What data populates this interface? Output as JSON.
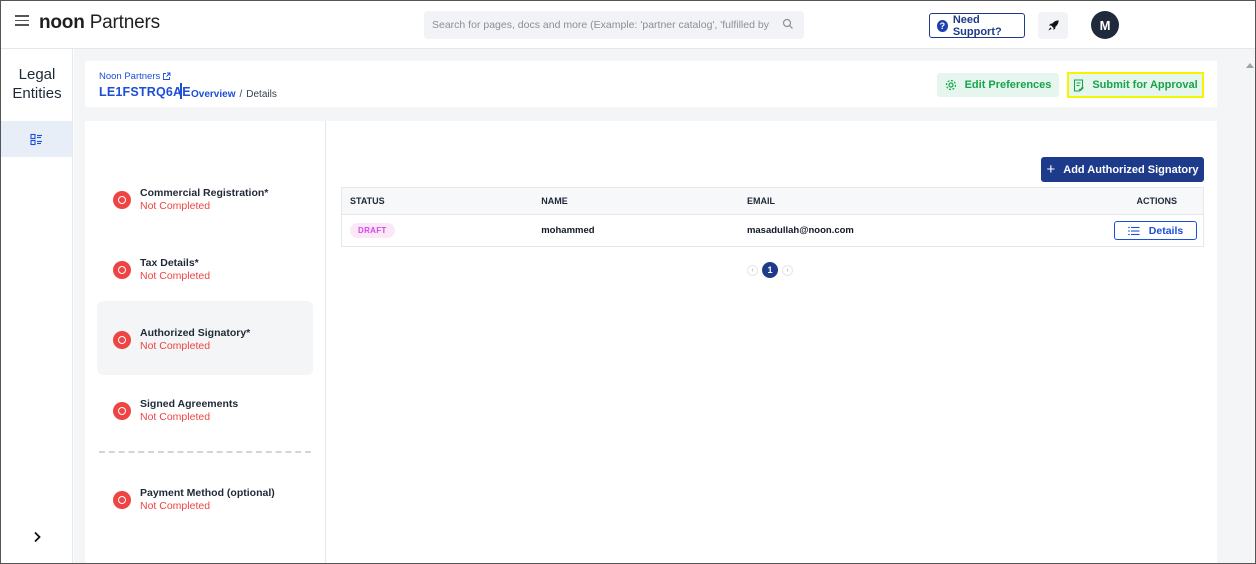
{
  "topbar": {
    "logo_bold": "noon",
    "logo_rest": " Partners",
    "search_placeholder": "Search for pages, docs and more (Example: 'partner catalog', 'fulfilled by p",
    "support_label": "Need Support?",
    "avatar_initial": "M"
  },
  "rail": {
    "title_line1": "Legal",
    "title_line2": "Entities"
  },
  "header": {
    "breadcrumb_link": "Noon Partners",
    "entity_id": "LE1FSTRQ6AE",
    "crumb_overview": "Overview",
    "crumb_separator": "/",
    "crumb_current": "Details",
    "edit_preferences_label": "Edit Preferences",
    "submit_label": "Submit for Approval"
  },
  "steps": [
    {
      "title": "Commercial Registration*",
      "status": "Not Completed"
    },
    {
      "title": "Tax Details*",
      "status": "Not Completed"
    },
    {
      "title": "Authorized Signatory*",
      "status": "Not Completed"
    },
    {
      "title": "Signed Agreements",
      "status": "Not Completed"
    },
    {
      "title": "Payment Method (optional)",
      "status": "Not Completed"
    }
  ],
  "panel": {
    "add_button_label": "Add Authorized Signatory",
    "columns": [
      "STATUS",
      "NAME",
      "EMAIL",
      "ACTIONS"
    ],
    "rows": [
      {
        "status": "DRAFT",
        "name": "mohammed",
        "email": "masadullah@noon.com",
        "action": "Details"
      }
    ],
    "pagination": {
      "prev": "‹",
      "current": "1",
      "next": "›"
    }
  },
  "colors": {
    "primary": "#1e3a8a",
    "link": "#1d4ed8",
    "success": "#16a34a",
    "error": "#ef4444",
    "highlight": "#f5f500"
  }
}
